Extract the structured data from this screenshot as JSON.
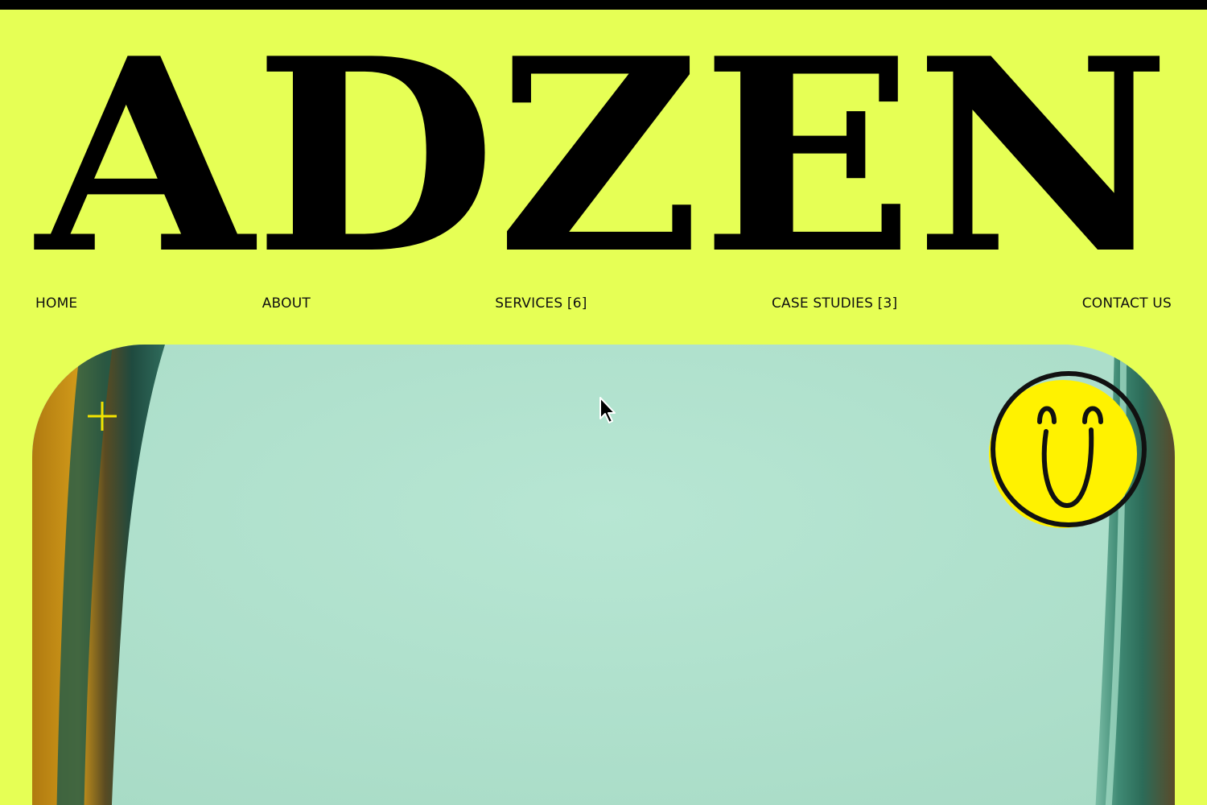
{
  "brand": {
    "name": "ADZEN"
  },
  "nav": {
    "items": [
      {
        "label": "HOME"
      },
      {
        "label": "ABOUT"
      },
      {
        "label": "SERVICES [6]"
      },
      {
        "label": "CASE STUDIES [3]"
      },
      {
        "label": "CONTACT US"
      }
    ]
  },
  "hero": {
    "add_icon": "plus-icon",
    "badge_icon": "smiley-face-icon"
  },
  "colors": {
    "background": "#e6ff55",
    "text": "#000000",
    "hero_fill": "#b2e3cf",
    "badge_yellow": "#fff200"
  }
}
